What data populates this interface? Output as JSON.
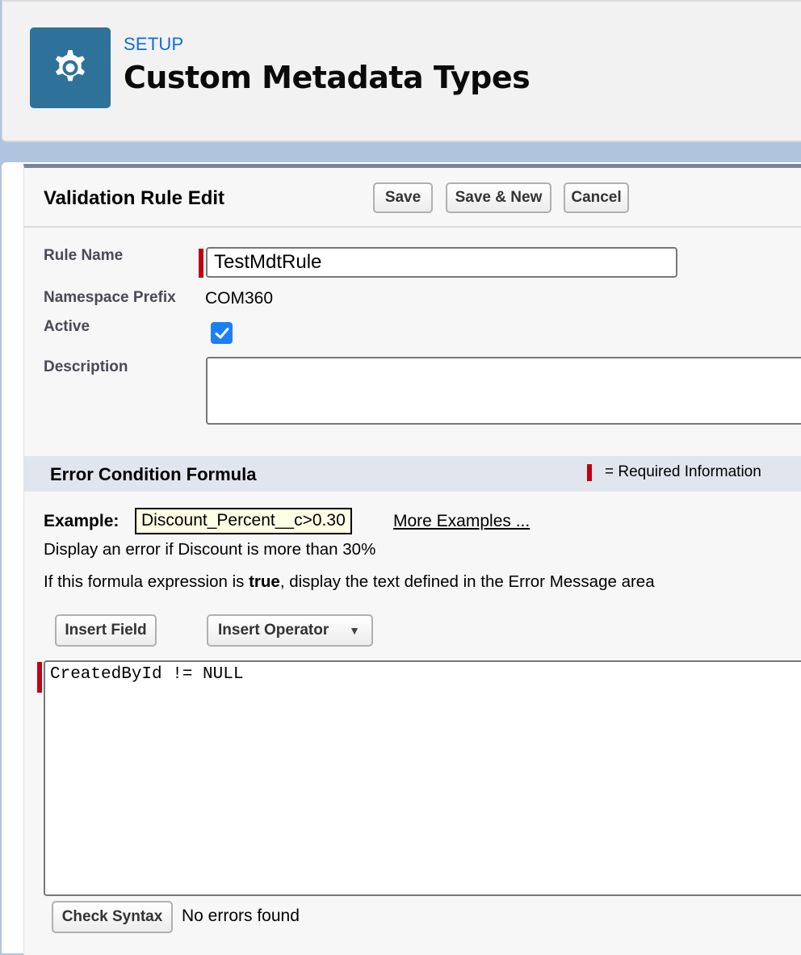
{
  "header": {
    "icon": "gear-icon",
    "kicker": "SETUP",
    "title": "Custom Metadata Types",
    "icon_bg_color": "#2f7299",
    "kicker_color": "#0d6fd6"
  },
  "panel": {
    "title": "Validation Rule Edit",
    "buttons": {
      "save": "Save",
      "save_new": "Save & New",
      "cancel": "Cancel"
    }
  },
  "form": {
    "rule_name": {
      "label": "Rule Name",
      "value": "TestMdtRule",
      "required": true
    },
    "namespace_prefix": {
      "label": "Namespace Prefix",
      "value": "COM360"
    },
    "active": {
      "label": "Active",
      "checked": true
    },
    "description": {
      "label": "Description",
      "value": ""
    }
  },
  "error_condition": {
    "section_title": "Error Condition Formula",
    "required_legend": "= Required Information",
    "required_color": "#c00012",
    "example_label": "Example:",
    "example_formula": "Discount_Percent__c>0.30",
    "more_examples_link": "More Examples ...",
    "example_description": "Display an error if Discount is more than 30%",
    "instruction_prefix": "If this formula expression is ",
    "instruction_bold": "true",
    "instruction_suffix": ", display the text defined in the Error Message area",
    "insert_field_button": "Insert Field",
    "insert_operator_button": "Insert Operator",
    "formula_value": "CreatedById != NULL",
    "check_syntax_button": "Check Syntax",
    "syntax_status": "No errors found"
  }
}
